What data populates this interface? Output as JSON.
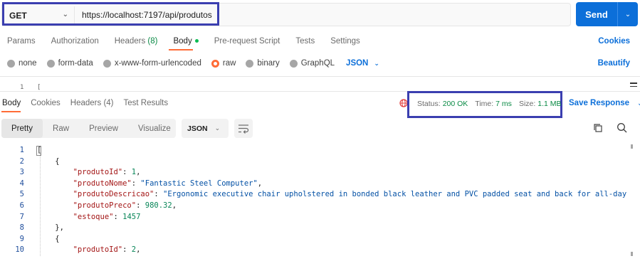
{
  "request": {
    "method": "GET",
    "url": "https://localhost:7197/api/produtos",
    "send_label": "Send"
  },
  "request_tabs": [
    {
      "label": "Params"
    },
    {
      "label": "Authorization"
    },
    {
      "label": "Headers",
      "count": "(8)"
    },
    {
      "label": "Body",
      "active": true
    },
    {
      "label": "Pre-request Script"
    },
    {
      "label": "Tests"
    },
    {
      "label": "Settings"
    }
  ],
  "cookies_label": "Cookies",
  "body_types": [
    {
      "label": "none"
    },
    {
      "label": "form-data"
    },
    {
      "label": "x-www-form-urlencoded"
    },
    {
      "label": "raw",
      "selected": true
    },
    {
      "label": "binary"
    },
    {
      "label": "GraphQL"
    }
  ],
  "body_format": "JSON",
  "beautify_label": "Beautify",
  "request_editor": {
    "line": "1",
    "code": "["
  },
  "response_tabs": [
    {
      "label": "Body",
      "active": true
    },
    {
      "label": "Cookies"
    },
    {
      "label": "Headers (4)"
    },
    {
      "label": "Test Results"
    }
  ],
  "status": {
    "status_key": "Status:",
    "status_value": "200 OK",
    "time_key": "Time:",
    "time_value": "7 ms",
    "size_key": "Size:",
    "size_value": "1.1 MB"
  },
  "save_response_label": "Save Response",
  "view_modes": [
    "Pretty",
    "Raw",
    "Preview",
    "Visualize"
  ],
  "response_format": "JSON",
  "code_lines": [
    {
      "n": "1",
      "tokens": [
        [
          "p",
          "["
        ]
      ]
    },
    {
      "n": "2",
      "tokens": [
        [
          "p",
          "    {"
        ]
      ]
    },
    {
      "n": "3",
      "tokens": [
        [
          "p",
          "        "
        ],
        [
          "k",
          "\"produtoId\""
        ],
        [
          "p",
          ": "
        ],
        [
          "n",
          "1"
        ],
        [
          "p",
          ","
        ]
      ]
    },
    {
      "n": "4",
      "tokens": [
        [
          "p",
          "        "
        ],
        [
          "k",
          "\"produtoNome\""
        ],
        [
          "p",
          ": "
        ],
        [
          "s",
          "\"Fantastic Steel Computer\""
        ],
        [
          "p",
          ","
        ]
      ]
    },
    {
      "n": "5",
      "tokens": [
        [
          "p",
          "        "
        ],
        [
          "k",
          "\"produtoDescricao\""
        ],
        [
          "p",
          ": "
        ],
        [
          "s",
          "\"Ergonomic executive chair upholstered in bonded black leather and PVC padded seat and back for all-day com"
        ]
      ]
    },
    {
      "n": "6",
      "tokens": [
        [
          "p",
          "        "
        ],
        [
          "k",
          "\"produtoPreco\""
        ],
        [
          "p",
          ": "
        ],
        [
          "n",
          "980.32"
        ],
        [
          "p",
          ","
        ]
      ]
    },
    {
      "n": "7",
      "tokens": [
        [
          "p",
          "        "
        ],
        [
          "k",
          "\"estoque\""
        ],
        [
          "p",
          ": "
        ],
        [
          "n",
          "1457"
        ]
      ]
    },
    {
      "n": "8",
      "tokens": [
        [
          "p",
          "    },"
        ]
      ]
    },
    {
      "n": "9",
      "tokens": [
        [
          "p",
          "    {"
        ]
      ]
    },
    {
      "n": "10",
      "tokens": [
        [
          "p",
          "        "
        ],
        [
          "k",
          "\"produtoId\""
        ],
        [
          "p",
          ": "
        ],
        [
          "n",
          "2"
        ],
        [
          "p",
          ","
        ]
      ]
    }
  ],
  "colors": {
    "accent": "#0c6fd9",
    "tab_indicator": "#ff6c37",
    "status_ok": "#0a8a45",
    "highlight_box": "#3b3fb0"
  }
}
